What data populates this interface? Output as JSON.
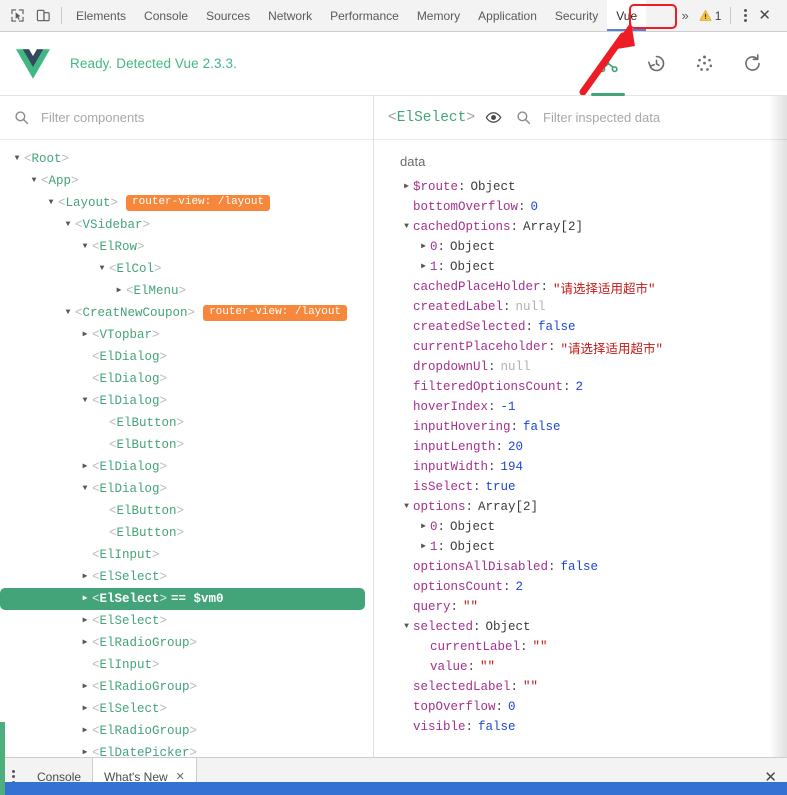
{
  "devtools": {
    "icons": {
      "inspect": "inspect-element-icon",
      "device": "device-toolbar-icon"
    },
    "tabs": [
      {
        "label": "Elements",
        "active": false
      },
      {
        "label": "Console",
        "active": false
      },
      {
        "label": "Sources",
        "active": false
      },
      {
        "label": "Network",
        "active": false
      },
      {
        "label": "Performance",
        "active": false
      },
      {
        "label": "Memory",
        "active": false
      },
      {
        "label": "Application",
        "active": false
      },
      {
        "label": "Security",
        "active": false
      },
      {
        "label": "Vue",
        "active": true
      }
    ],
    "overflow_label": "»",
    "warning_count": "1",
    "close_label": "✕",
    "annotation": {
      "color": "#ee1c25",
      "target": "Vue"
    }
  },
  "vue_header": {
    "status_text": "Ready. Detected Vue 2.3.3.",
    "status_color": "#42b883",
    "tools": [
      {
        "name": "components-tab-icon",
        "active": true
      },
      {
        "name": "history-tab-icon",
        "active": false
      },
      {
        "name": "events-tab-icon",
        "active": false
      },
      {
        "name": "refresh-button-icon",
        "active": false
      }
    ]
  },
  "left_pane": {
    "filter_placeholder": "Filter components",
    "tree": [
      {
        "depth": 0,
        "arrow": "down",
        "tag": "Root",
        "badge": ""
      },
      {
        "depth": 1,
        "arrow": "down",
        "tag": "App",
        "badge": ""
      },
      {
        "depth": 2,
        "arrow": "down",
        "tag": "Layout",
        "badge": "router-view: /layout"
      },
      {
        "depth": 3,
        "arrow": "down",
        "tag": "VSidebar",
        "badge": ""
      },
      {
        "depth": 4,
        "arrow": "down",
        "tag": "ElRow",
        "badge": ""
      },
      {
        "depth": 5,
        "arrow": "down",
        "tag": "ElCol",
        "badge": ""
      },
      {
        "depth": 6,
        "arrow": "right",
        "tag": "ElMenu",
        "badge": ""
      },
      {
        "depth": 3,
        "arrow": "down",
        "tag": "CreatNewCoupon",
        "badge": "router-view: /layout"
      },
      {
        "depth": 4,
        "arrow": "right",
        "tag": "VTopbar",
        "badge": ""
      },
      {
        "depth": 4,
        "arrow": "none",
        "tag": "ElDialog",
        "badge": ""
      },
      {
        "depth": 4,
        "arrow": "none",
        "tag": "ElDialog",
        "badge": ""
      },
      {
        "depth": 4,
        "arrow": "down",
        "tag": "ElDialog",
        "badge": ""
      },
      {
        "depth": 5,
        "arrow": "none",
        "tag": "ElButton",
        "badge": ""
      },
      {
        "depth": 5,
        "arrow": "none",
        "tag": "ElButton",
        "badge": ""
      },
      {
        "depth": 4,
        "arrow": "right",
        "tag": "ElDialog",
        "badge": ""
      },
      {
        "depth": 4,
        "arrow": "down",
        "tag": "ElDialog",
        "badge": ""
      },
      {
        "depth": 5,
        "arrow": "none",
        "tag": "ElButton",
        "badge": ""
      },
      {
        "depth": 5,
        "arrow": "none",
        "tag": "ElButton",
        "badge": ""
      },
      {
        "depth": 4,
        "arrow": "none",
        "tag": "ElInput",
        "badge": ""
      },
      {
        "depth": 4,
        "arrow": "right",
        "tag": "ElSelect",
        "badge": ""
      },
      {
        "depth": 4,
        "arrow": "right",
        "tag": "ElSelect",
        "badge": "",
        "selected": true,
        "vm": "== $vm0"
      },
      {
        "depth": 4,
        "arrow": "right",
        "tag": "ElSelect",
        "badge": ""
      },
      {
        "depth": 4,
        "arrow": "right",
        "tag": "ElRadioGroup",
        "badge": ""
      },
      {
        "depth": 4,
        "arrow": "none",
        "tag": "ElInput",
        "badge": ""
      },
      {
        "depth": 4,
        "arrow": "right",
        "tag": "ElRadioGroup",
        "badge": ""
      },
      {
        "depth": 4,
        "arrow": "right",
        "tag": "ElSelect",
        "badge": ""
      },
      {
        "depth": 4,
        "arrow": "right",
        "tag": "ElRadioGroup",
        "badge": ""
      },
      {
        "depth": 4,
        "arrow": "right",
        "tag": "ElDatePicker",
        "badge": ""
      }
    ]
  },
  "right_pane": {
    "inspected_component": "ElSelect",
    "eye_icon": "eye-icon",
    "filter_placeholder": "Filter inspected data",
    "section_title": "data",
    "rows": [
      {
        "depth": 0,
        "arrow": "right",
        "key": "$route",
        "value": "Object",
        "type": "obj"
      },
      {
        "depth": 0,
        "arrow": "none",
        "key": "bottomOverflow",
        "value": "0",
        "type": "num"
      },
      {
        "depth": 0,
        "arrow": "down",
        "key": "cachedOptions",
        "value": "Array[2]",
        "type": "obj"
      },
      {
        "depth": 1,
        "arrow": "right",
        "key": "0",
        "value": "Object",
        "type": "obj"
      },
      {
        "depth": 1,
        "arrow": "right",
        "key": "1",
        "value": "Object",
        "type": "obj"
      },
      {
        "depth": 0,
        "arrow": "none",
        "key": "cachedPlaceHolder",
        "value": "\"请选择适用超市\"",
        "type": "str"
      },
      {
        "depth": 0,
        "arrow": "none",
        "key": "createdLabel",
        "value": "null",
        "type": "null"
      },
      {
        "depth": 0,
        "arrow": "none",
        "key": "createdSelected",
        "value": "false",
        "type": "bool"
      },
      {
        "depth": 0,
        "arrow": "none",
        "key": "currentPlaceholder",
        "value": "\"请选择适用超市\"",
        "type": "str"
      },
      {
        "depth": 0,
        "arrow": "none",
        "key": "dropdownUl",
        "value": "null",
        "type": "null"
      },
      {
        "depth": 0,
        "arrow": "none",
        "key": "filteredOptionsCount",
        "value": "2",
        "type": "num"
      },
      {
        "depth": 0,
        "arrow": "none",
        "key": "hoverIndex",
        "value": "-1",
        "type": "num"
      },
      {
        "depth": 0,
        "arrow": "none",
        "key": "inputHovering",
        "value": "false",
        "type": "bool"
      },
      {
        "depth": 0,
        "arrow": "none",
        "key": "inputLength",
        "value": "20",
        "type": "num"
      },
      {
        "depth": 0,
        "arrow": "none",
        "key": "inputWidth",
        "value": "194",
        "type": "num"
      },
      {
        "depth": 0,
        "arrow": "none",
        "key": "isSelect",
        "value": "true",
        "type": "bool"
      },
      {
        "depth": 0,
        "arrow": "down",
        "key": "options",
        "value": "Array[2]",
        "type": "obj"
      },
      {
        "depth": 1,
        "arrow": "right",
        "key": "0",
        "value": "Object",
        "type": "obj"
      },
      {
        "depth": 1,
        "arrow": "right",
        "key": "1",
        "value": "Object",
        "type": "obj"
      },
      {
        "depth": 0,
        "arrow": "none",
        "key": "optionsAllDisabled",
        "value": "false",
        "type": "bool"
      },
      {
        "depth": 0,
        "arrow": "none",
        "key": "optionsCount",
        "value": "2",
        "type": "num"
      },
      {
        "depth": 0,
        "arrow": "none",
        "key": "query",
        "value": "\"\"",
        "type": "str"
      },
      {
        "depth": 0,
        "arrow": "down",
        "key": "selected",
        "value": "Object",
        "type": "obj"
      },
      {
        "depth": 1,
        "arrow": "none",
        "key": "currentLabel",
        "value": "\"\"",
        "type": "str"
      },
      {
        "depth": 1,
        "arrow": "none",
        "key": "value",
        "value": "\"\"",
        "type": "str"
      },
      {
        "depth": 0,
        "arrow": "none",
        "key": "selectedLabel",
        "value": "\"\"",
        "type": "str"
      },
      {
        "depth": 0,
        "arrow": "none",
        "key": "topOverflow",
        "value": "0",
        "type": "num"
      },
      {
        "depth": 0,
        "arrow": "none",
        "key": "visible",
        "value": "false",
        "type": "bool"
      }
    ]
  },
  "drawer": {
    "tabs": [
      {
        "label": "Console",
        "active": false,
        "closable": false
      },
      {
        "label": "What's New",
        "active": true,
        "closable": true
      }
    ],
    "close_label": "✕"
  },
  "colors": {
    "vue_green": "#42b883",
    "selected_green": "#44a479",
    "router_orange": "#f7873a",
    "key_purple": "#a3308f",
    "string_red": "#c41a16",
    "number_blue": "#1c46d6",
    "annotation_red": "#ee1c25",
    "strip_blue": "#3571d3"
  }
}
